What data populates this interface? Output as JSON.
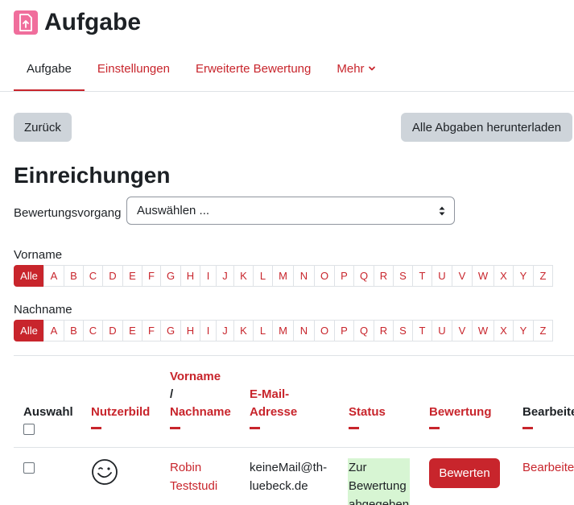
{
  "header": {
    "title": "Aufgabe",
    "icon": "assignment-upload-icon",
    "icon_color": "#f06e9c"
  },
  "tabs": [
    {
      "label": "Aufgabe",
      "active": true
    },
    {
      "label": "Einstellungen"
    },
    {
      "label": "Erweiterte Bewertung"
    },
    {
      "label": "Mehr"
    }
  ],
  "buttons": {
    "back": "Zurück",
    "download_all": "Alle Abgaben herunterladen"
  },
  "section": {
    "title": "Einreichungen"
  },
  "grading": {
    "label": "Bewertungsvorgang",
    "select_value": "Auswählen ..."
  },
  "initials": {
    "firstname_label": "Vorname",
    "lastname_label": "Nachname",
    "all_label": "Alle",
    "letters": [
      "A",
      "B",
      "C",
      "D",
      "E",
      "F",
      "G",
      "H",
      "I",
      "J",
      "K",
      "L",
      "M",
      "N",
      "O",
      "P",
      "Q",
      "R",
      "S",
      "T",
      "U",
      "V",
      "W",
      "X",
      "Y",
      "Z"
    ]
  },
  "table": {
    "headers": {
      "select": "Auswahl",
      "picture": "Nutzerbild",
      "firstname": "Vorname",
      "slash": "/",
      "lastname": "Nachname",
      "email_line1": "E-Mail-",
      "email_line2": "Adresse",
      "status": "Status",
      "grade": "Bewertung",
      "edit": "Bearbeiten"
    },
    "rows": [
      {
        "first": "Robin",
        "last": "Teststudi",
        "email_line1": "keineMail@th-",
        "email_line2": "luebeck.de",
        "status_line1": "Zur",
        "status_line2": "Bewertung",
        "status_line3": "abgegeben",
        "grade_button": "Bewerten",
        "edit_link": "Bearbeiten"
      }
    ]
  },
  "colors": {
    "accent": "#c8252c",
    "secondary_button": "#ced4da",
    "status_bg": "#d7f5d3"
  }
}
